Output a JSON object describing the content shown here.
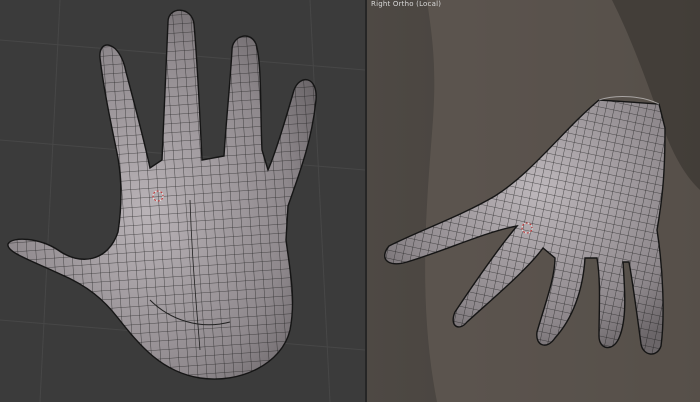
{
  "viewports": {
    "left": {
      "label": "",
      "object": "hand-mesh",
      "view": "top-down palm"
    },
    "right": {
      "label": "Right Ortho (Local)",
      "object": "hand-mesh",
      "view": "side three-quarter"
    }
  },
  "colors": {
    "viewport_bg_left": "#3b3b3b",
    "viewport_bg_right": "#4b4641",
    "grid_line": "#454545",
    "mesh_fill": "#9a9498",
    "mesh_wire": "#1a1a1a",
    "background_figure": "#6b625a"
  }
}
